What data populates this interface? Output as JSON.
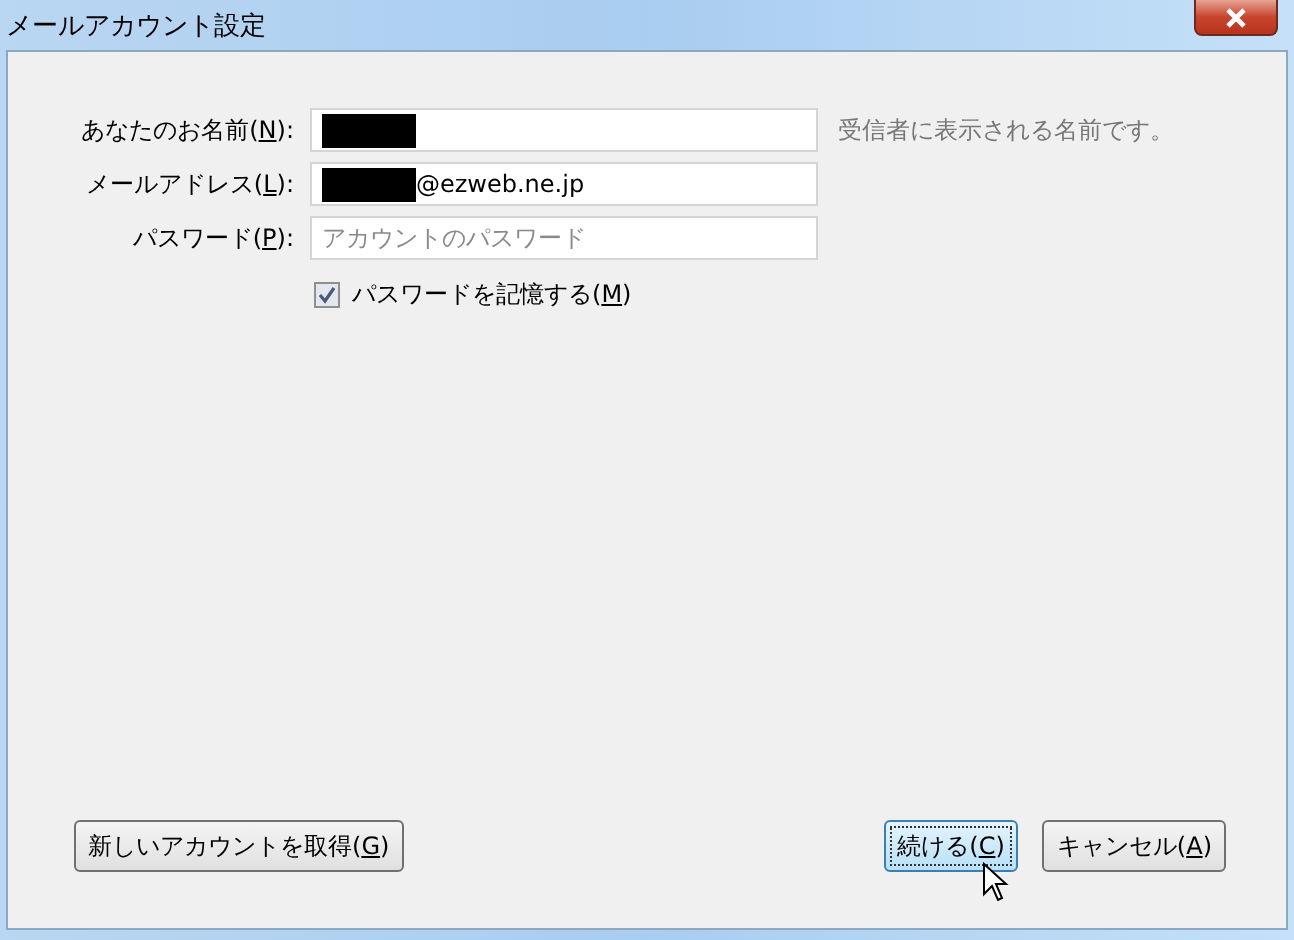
{
  "window": {
    "title": "メールアカウント設定"
  },
  "fields": [
    {
      "label_before": "あなたのお名前(",
      "key": "N",
      "label_after": "):",
      "redacted": true,
      "hint": "受信者に表示される名前です。"
    },
    {
      "label_before": "メールアドレス(",
      "key": "L",
      "label_after": "):",
      "value": "@ezweb.ne.jp",
      "redacted": true
    },
    {
      "label_before": "パスワード(",
      "key": "P",
      "label_after": "):",
      "placeholder": "アカウントのパスワード"
    }
  ],
  "remember": {
    "label_before": "パスワードを記憶する(",
    "key": "M",
    "label_after": ")",
    "checked": true
  },
  "buttons": [
    {
      "label_before": "新しいアカウントを取得(",
      "key": "G",
      "label_after": ")",
      "default": false,
      "hovered": false
    },
    {
      "label_before": "続ける(",
      "key": "C",
      "label_after": ")",
      "default": true,
      "hovered": true
    },
    {
      "label_before": "キャンセル(",
      "key": "A",
      "label_after": ")",
      "default": false,
      "hovered": false
    }
  ]
}
